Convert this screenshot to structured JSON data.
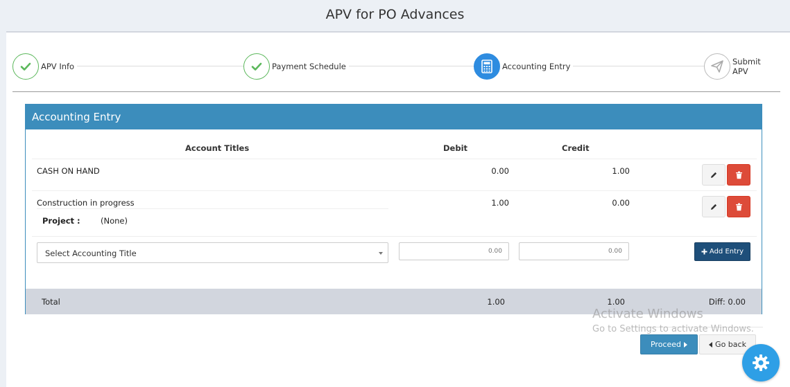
{
  "page_title": "APV for PO Advances",
  "wizard": {
    "steps": [
      {
        "label": "APV Info",
        "state": "done",
        "icon": "check-icon"
      },
      {
        "label": "Payment Schedule",
        "state": "done",
        "icon": "check-icon"
      },
      {
        "label": "Accounting Entry",
        "state": "active",
        "icon": "calculator-icon"
      },
      {
        "label": "Submit APV",
        "state": "pending",
        "icon": "paper-plane-icon"
      }
    ]
  },
  "accounting_box": {
    "title": "Accounting Entry",
    "columns": {
      "account_titles": "Account Titles",
      "debit": "Debit",
      "credit": "Credit"
    },
    "entries": [
      {
        "account": "CASH ON HAND",
        "debit": "0.00",
        "credit": "1.00"
      },
      {
        "account": "Construction in progress",
        "debit": "1.00",
        "credit": "0.00",
        "project_label": "Project :",
        "project_value": "(None)"
      }
    ],
    "new_entry": {
      "select_placeholder": "Select Accounting Title",
      "debit_placeholder": "0.00",
      "credit_placeholder": "0.00",
      "add_label": "Add Entry"
    },
    "totals": {
      "label": "Total",
      "debit": "1.00",
      "credit": "1.00",
      "diff": "Diff: 0.00"
    }
  },
  "actions": {
    "proceed_label": "Proceed",
    "back_label": "Go back"
  },
  "watermark": {
    "line1": "Activate Windows",
    "line2": "Go to Settings to activate Windows."
  },
  "colors": {
    "primary": "#3c8dbc",
    "success": "#5cb85c",
    "danger": "#dd4b39",
    "navy": "#1e4f7a",
    "active_step": "#2e8ce0"
  }
}
